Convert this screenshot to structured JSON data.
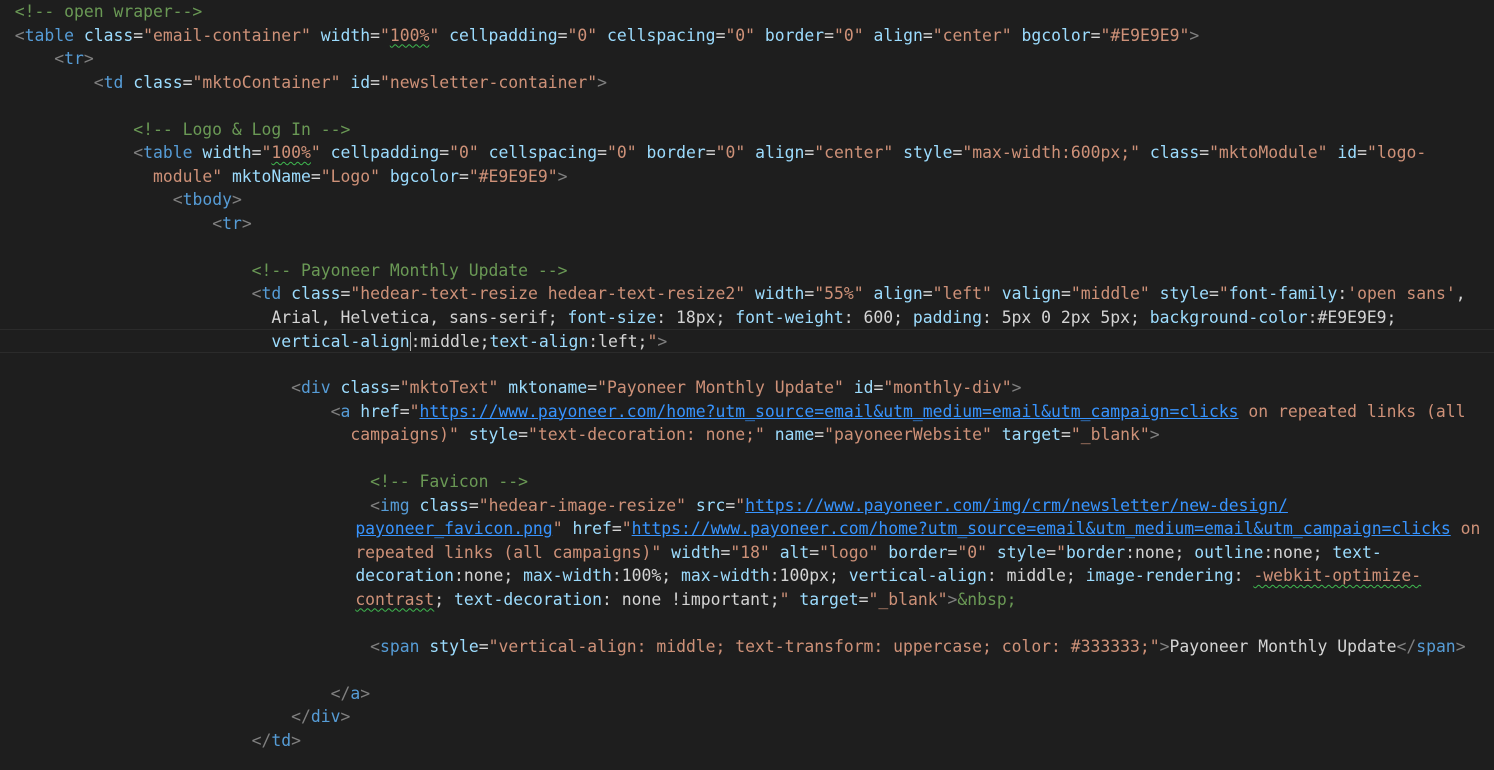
{
  "editor": {
    "colors": {
      "background": "#1e1e1e",
      "comment": "#6a9955",
      "tag": "#569cd6",
      "attribute": "#9cdcfe",
      "string": "#ce9178",
      "link": "#3794ff",
      "text": "#d4d4d4"
    },
    "lines": [
      {
        "indent": 1.5,
        "tokens": [
          [
            "cmt",
            "<!-- open wraper-->"
          ]
        ]
      },
      {
        "indent": 1.5,
        "tokens": [
          [
            "punc",
            "<"
          ],
          [
            "tag",
            "table"
          ],
          [
            "txt",
            " "
          ],
          [
            "attr",
            "class"
          ],
          [
            "txt",
            "="
          ],
          [
            "str",
            "\"email-container\""
          ],
          [
            "txt",
            " "
          ],
          [
            "attr",
            "width"
          ],
          [
            "txt",
            "="
          ],
          [
            "str",
            "\""
          ],
          [
            "str squig",
            "100%"
          ],
          [
            "str",
            "\""
          ],
          [
            "txt",
            " "
          ],
          [
            "attr",
            "cellpadding"
          ],
          [
            "txt",
            "="
          ],
          [
            "str",
            "\"0\""
          ],
          [
            "txt",
            " "
          ],
          [
            "attr",
            "cellspacing"
          ],
          [
            "txt",
            "="
          ],
          [
            "str",
            "\"0\""
          ],
          [
            "txt",
            " "
          ],
          [
            "attr",
            "border"
          ],
          [
            "txt",
            "="
          ],
          [
            "str",
            "\"0\""
          ],
          [
            "txt",
            " "
          ],
          [
            "attr",
            "align"
          ],
          [
            "txt",
            "="
          ],
          [
            "str",
            "\"center\""
          ],
          [
            "txt",
            " "
          ],
          [
            "attr",
            "bgcolor"
          ],
          [
            "txt",
            "="
          ],
          [
            "str",
            "\"#E9E9E9\""
          ],
          [
            "punc",
            ">"
          ]
        ]
      },
      {
        "indent": 5.5,
        "tokens": [
          [
            "punc",
            "<"
          ],
          [
            "tag",
            "tr"
          ],
          [
            "punc",
            ">"
          ]
        ]
      },
      {
        "indent": 9.5,
        "tokens": [
          [
            "punc",
            "<"
          ],
          [
            "tag",
            "td"
          ],
          [
            "txt",
            " "
          ],
          [
            "attr",
            "class"
          ],
          [
            "txt",
            "="
          ],
          [
            "str",
            "\"mktoContainer\""
          ],
          [
            "txt",
            " "
          ],
          [
            "attr",
            "id"
          ],
          [
            "txt",
            "="
          ],
          [
            "str",
            "\"newsletter-container\""
          ],
          [
            "punc",
            ">"
          ]
        ]
      },
      {
        "indent": 0,
        "tokens": []
      },
      {
        "indent": 13.5,
        "tokens": [
          [
            "cmt",
            "<!-- Logo & Log In -->"
          ]
        ]
      },
      {
        "indent": 13.5,
        "tokens": [
          [
            "punc",
            "<"
          ],
          [
            "tag",
            "table"
          ],
          [
            "txt",
            " "
          ],
          [
            "attr",
            "width"
          ],
          [
            "txt",
            "="
          ],
          [
            "str",
            "\""
          ],
          [
            "str squig",
            "100%"
          ],
          [
            "str",
            "\""
          ],
          [
            "txt",
            " "
          ],
          [
            "attr",
            "cellpadding"
          ],
          [
            "txt",
            "="
          ],
          [
            "str",
            "\"0\""
          ],
          [
            "txt",
            " "
          ],
          [
            "attr",
            "cellspacing"
          ],
          [
            "txt",
            "="
          ],
          [
            "str",
            "\"0\""
          ],
          [
            "txt",
            " "
          ],
          [
            "attr",
            "border"
          ],
          [
            "txt",
            "="
          ],
          [
            "str",
            "\"0\""
          ],
          [
            "txt",
            " "
          ],
          [
            "attr",
            "align"
          ],
          [
            "txt",
            "="
          ],
          [
            "str",
            "\"center\""
          ],
          [
            "txt",
            " "
          ],
          [
            "attr",
            "style"
          ],
          [
            "txt",
            "="
          ],
          [
            "str",
            "\"max-width:600px;\""
          ],
          [
            "txt",
            " "
          ],
          [
            "attr",
            "class"
          ],
          [
            "txt",
            "="
          ],
          [
            "str",
            "\"mktoModule\""
          ],
          [
            "txt",
            " "
          ],
          [
            "attr",
            "id"
          ],
          [
            "txt",
            "="
          ],
          [
            "str",
            "\"logo-"
          ]
        ]
      },
      {
        "indent": 15.5,
        "tokens": [
          [
            "str",
            "module\""
          ],
          [
            "txt",
            " "
          ],
          [
            "attr",
            "mktoName"
          ],
          [
            "txt",
            "="
          ],
          [
            "str",
            "\"Logo\""
          ],
          [
            "txt",
            " "
          ],
          [
            "attr",
            "bgcolor"
          ],
          [
            "txt",
            "="
          ],
          [
            "str",
            "\"#E9E9E9\""
          ],
          [
            "punc",
            ">"
          ]
        ]
      },
      {
        "indent": 17.5,
        "tokens": [
          [
            "punc",
            "<"
          ],
          [
            "tag",
            "tbody"
          ],
          [
            "punc",
            ">"
          ]
        ]
      },
      {
        "indent": 21.5,
        "tokens": [
          [
            "punc",
            "<"
          ],
          [
            "tag",
            "tr"
          ],
          [
            "punc",
            ">"
          ]
        ]
      },
      {
        "indent": 0,
        "tokens": []
      },
      {
        "indent": 25.5,
        "tokens": [
          [
            "cmt",
            "<!-- Payoneer Monthly Update -->"
          ]
        ]
      },
      {
        "indent": 25.5,
        "tokens": [
          [
            "punc",
            "<"
          ],
          [
            "tag",
            "td"
          ],
          [
            "txt",
            " "
          ],
          [
            "attr",
            "class"
          ],
          [
            "txt",
            "="
          ],
          [
            "str",
            "\"hedear-text-resize hedear-text-resize2\""
          ],
          [
            "txt",
            " "
          ],
          [
            "attr",
            "width"
          ],
          [
            "txt",
            "="
          ],
          [
            "str",
            "\"55%\""
          ],
          [
            "txt",
            " "
          ],
          [
            "attr",
            "align"
          ],
          [
            "txt",
            "="
          ],
          [
            "str",
            "\"left\""
          ],
          [
            "txt",
            " "
          ],
          [
            "attr",
            "valign"
          ],
          [
            "txt",
            "="
          ],
          [
            "str",
            "\"middle\""
          ],
          [
            "txt",
            " "
          ],
          [
            "attr",
            "style"
          ],
          [
            "txt",
            "="
          ],
          [
            "str",
            "\""
          ],
          [
            "attr",
            "font-family"
          ],
          [
            "txt",
            ":"
          ],
          [
            "str",
            "'open sans'"
          ],
          [
            "txt",
            ","
          ]
        ]
      },
      {
        "indent": 27.5,
        "tokens": [
          [
            "txt",
            "Arial, Helvetica, sans-serif; "
          ],
          [
            "attr",
            "font-size"
          ],
          [
            "txt",
            ": 18px; "
          ],
          [
            "attr",
            "font-weight"
          ],
          [
            "txt",
            ": 600; "
          ],
          [
            "attr",
            "padding"
          ],
          [
            "txt",
            ": 5px 0 2px 5px; "
          ],
          [
            "attr",
            "background-color"
          ],
          [
            "txt",
            ":#E9E9E9;"
          ]
        ]
      },
      {
        "indent": 27.5,
        "current": true,
        "tokens": [
          [
            "attr",
            "vertical-align"
          ],
          [
            "cursor",
            ""
          ],
          [
            "txt",
            ":middle;"
          ],
          [
            "attr",
            "text-align"
          ],
          [
            "txt",
            ":left;"
          ],
          [
            "str",
            "\""
          ],
          [
            "punc",
            ">"
          ]
        ]
      },
      {
        "indent": 0,
        "tokens": []
      },
      {
        "indent": 29.5,
        "tokens": [
          [
            "punc",
            "<"
          ],
          [
            "tag",
            "div"
          ],
          [
            "txt",
            " "
          ],
          [
            "attr",
            "class"
          ],
          [
            "txt",
            "="
          ],
          [
            "str",
            "\"mktoText\""
          ],
          [
            "txt",
            " "
          ],
          [
            "attr",
            "mktoname"
          ],
          [
            "txt",
            "="
          ],
          [
            "str",
            "\"Payoneer Monthly Update\""
          ],
          [
            "txt",
            " "
          ],
          [
            "attr",
            "id"
          ],
          [
            "txt",
            "="
          ],
          [
            "str",
            "\"monthly-div\""
          ],
          [
            "punc",
            ">"
          ]
        ]
      },
      {
        "indent": 33.5,
        "tokens": [
          [
            "punc",
            "<"
          ],
          [
            "tag",
            "a"
          ],
          [
            "txt",
            " "
          ],
          [
            "attr",
            "href"
          ],
          [
            "txt",
            "="
          ],
          [
            "str",
            "\""
          ],
          [
            "link",
            "https://www.payoneer.com/home?utm_source=email&utm_medium=email&utm_campaign=clicks"
          ],
          [
            "txt",
            " "
          ],
          [
            "str",
            "on repeated links (all"
          ]
        ]
      },
      {
        "indent": 35.5,
        "tokens": [
          [
            "str",
            "campaigns)\""
          ],
          [
            "txt",
            " "
          ],
          [
            "attr",
            "style"
          ],
          [
            "txt",
            "="
          ],
          [
            "str",
            "\"text-decoration: none;\""
          ],
          [
            "txt",
            " "
          ],
          [
            "attr",
            "name"
          ],
          [
            "txt",
            "="
          ],
          [
            "str",
            "\"payoneerWebsite\""
          ],
          [
            "txt",
            " "
          ],
          [
            "attr",
            "target"
          ],
          [
            "txt",
            "="
          ],
          [
            "str",
            "\"_blank\""
          ],
          [
            "punc",
            ">"
          ]
        ]
      },
      {
        "indent": 0,
        "tokens": []
      },
      {
        "indent": 37.5,
        "tokens": [
          [
            "cmt",
            "<!-- Favicon -->"
          ]
        ]
      },
      {
        "indent": 37.5,
        "tokens": [
          [
            "punc",
            "<"
          ],
          [
            "tag",
            "img"
          ],
          [
            "txt",
            " "
          ],
          [
            "attr",
            "class"
          ],
          [
            "txt",
            "="
          ],
          [
            "str",
            "\"hedear-image-resize\""
          ],
          [
            "txt",
            " "
          ],
          [
            "attr",
            "src"
          ],
          [
            "txt",
            "="
          ],
          [
            "str",
            "\""
          ],
          [
            "link",
            "https://www.payoneer.com/img/crm/newsletter/new-design/"
          ]
        ]
      },
      {
        "indent": 36,
        "tokens": [
          [
            "link",
            "payoneer_favicon.png"
          ],
          [
            "str",
            "\""
          ],
          [
            "txt",
            " "
          ],
          [
            "attr",
            "href"
          ],
          [
            "txt",
            "="
          ],
          [
            "str",
            "\""
          ],
          [
            "link",
            "https://www.payoneer.com/home?utm_source=email&utm_medium=email&utm_campaign=clicks"
          ],
          [
            "txt",
            " "
          ],
          [
            "str",
            "on"
          ]
        ]
      },
      {
        "indent": 36,
        "tokens": [
          [
            "str",
            "repeated links (all campaigns)\""
          ],
          [
            "txt",
            " "
          ],
          [
            "attr",
            "width"
          ],
          [
            "txt",
            "="
          ],
          [
            "str",
            "\"18\""
          ],
          [
            "txt",
            " "
          ],
          [
            "attr",
            "alt"
          ],
          [
            "txt",
            "="
          ],
          [
            "str",
            "\"logo\""
          ],
          [
            "txt",
            " "
          ],
          [
            "attr",
            "border"
          ],
          [
            "txt",
            "="
          ],
          [
            "str",
            "\"0\""
          ],
          [
            "txt",
            " "
          ],
          [
            "attr",
            "style"
          ],
          [
            "txt",
            "="
          ],
          [
            "str",
            "\""
          ],
          [
            "attr",
            "border"
          ],
          [
            "txt",
            ":none; "
          ],
          [
            "attr",
            "outline"
          ],
          [
            "txt",
            ":none; "
          ],
          [
            "attr",
            "text-"
          ]
        ]
      },
      {
        "indent": 36,
        "tokens": [
          [
            "attr",
            "decoration"
          ],
          [
            "txt",
            ":none; "
          ],
          [
            "attr",
            "max-width"
          ],
          [
            "txt",
            ":100%; "
          ],
          [
            "attr",
            "max-width"
          ],
          [
            "txt",
            ":100px; "
          ],
          [
            "attr",
            "vertical-align"
          ],
          [
            "txt",
            ": middle; "
          ],
          [
            "attr",
            "image-rendering"
          ],
          [
            "txt",
            ": "
          ],
          [
            "str squig",
            "-webkit-optimize-"
          ]
        ]
      },
      {
        "indent": 36,
        "tokens": [
          [
            "str squig",
            "contrast"
          ],
          [
            "txt",
            "; "
          ],
          [
            "attr",
            "text-decoration"
          ],
          [
            "txt",
            ": none !important;"
          ],
          [
            "str",
            "\""
          ],
          [
            "txt",
            " "
          ],
          [
            "attr",
            "target"
          ],
          [
            "txt",
            "="
          ],
          [
            "str",
            "\"_blank\""
          ],
          [
            "punc",
            ">"
          ],
          [
            "cmt",
            "&nbsp;"
          ]
        ]
      },
      {
        "indent": 0,
        "tokens": []
      },
      {
        "indent": 37.5,
        "tokens": [
          [
            "punc",
            "<"
          ],
          [
            "tag",
            "span"
          ],
          [
            "txt",
            " "
          ],
          [
            "attr",
            "style"
          ],
          [
            "txt",
            "="
          ],
          [
            "str",
            "\"vertical-align: middle; text-transform: uppercase; color: #333333;\""
          ],
          [
            "punc",
            ">"
          ],
          [
            "txt",
            "Payoneer Monthly Update"
          ],
          [
            "punc",
            "</"
          ],
          [
            "tag",
            "span"
          ],
          [
            "punc",
            ">"
          ]
        ]
      },
      {
        "indent": 0,
        "tokens": []
      },
      {
        "indent": 33.5,
        "tokens": [
          [
            "punc",
            "</"
          ],
          [
            "tag",
            "a"
          ],
          [
            "punc",
            ">"
          ]
        ]
      },
      {
        "indent": 29.5,
        "tokens": [
          [
            "punc",
            "</"
          ],
          [
            "tag",
            "div"
          ],
          [
            "punc",
            ">"
          ]
        ]
      },
      {
        "indent": 25.5,
        "tokens": [
          [
            "punc",
            "</"
          ],
          [
            "tag",
            "td"
          ],
          [
            "punc",
            ">"
          ]
        ]
      }
    ]
  }
}
